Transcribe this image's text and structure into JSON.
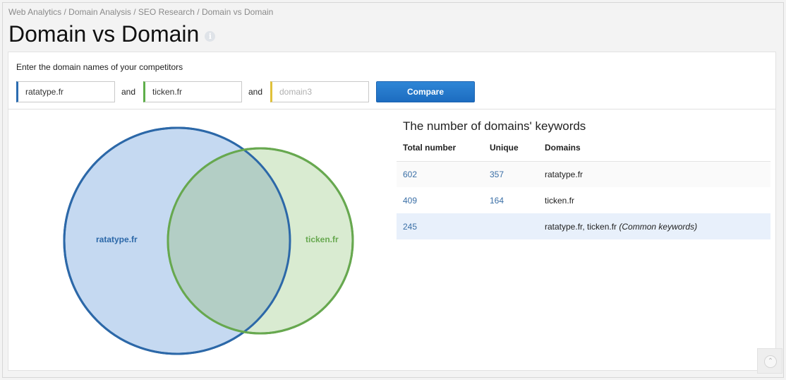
{
  "breadcrumb": [
    "Web Analytics",
    "Domain Analysis",
    "SEO Research",
    "Domain vs Domain"
  ],
  "breadcrumb_separator": " / ",
  "page": {
    "title": "Domain vs Domain",
    "info_icon": "info-icon"
  },
  "form": {
    "label": "Enter the domain names of your competitors",
    "domains": [
      {
        "value": "ratatype.fr",
        "placeholder": "",
        "color": "#2b6cb0"
      },
      {
        "value": "ticken.fr",
        "placeholder": "",
        "color": "#5fae4a"
      },
      {
        "value": "",
        "placeholder": "domain3",
        "color": "#e0c13a"
      }
    ],
    "and_label": "and",
    "compare_label": "Compare"
  },
  "venn": {
    "a": {
      "label": "ratatype.fr",
      "color": "#2c68a8",
      "fill": "#c5d9f1"
    },
    "b": {
      "label": "ticken.fr",
      "color": "#67a84f",
      "fill": "#d9ebd1"
    },
    "overlap_fill": "#b3cec5"
  },
  "keywords_table": {
    "title": "The number of domains' keywords",
    "headers": [
      "Total number",
      "Unique",
      "Domains"
    ],
    "rows": [
      {
        "total": "602",
        "unique": "357",
        "domains": "ratatype.fr",
        "note": ""
      },
      {
        "total": "409",
        "unique": "164",
        "domains": "ticken.fr",
        "note": ""
      },
      {
        "total": "245",
        "unique": "",
        "domains": "ratatype.fr, ticken.fr",
        "note": "(Common keywords)"
      }
    ]
  },
  "scroll_top": {
    "icon": "chevron-up-icon"
  }
}
